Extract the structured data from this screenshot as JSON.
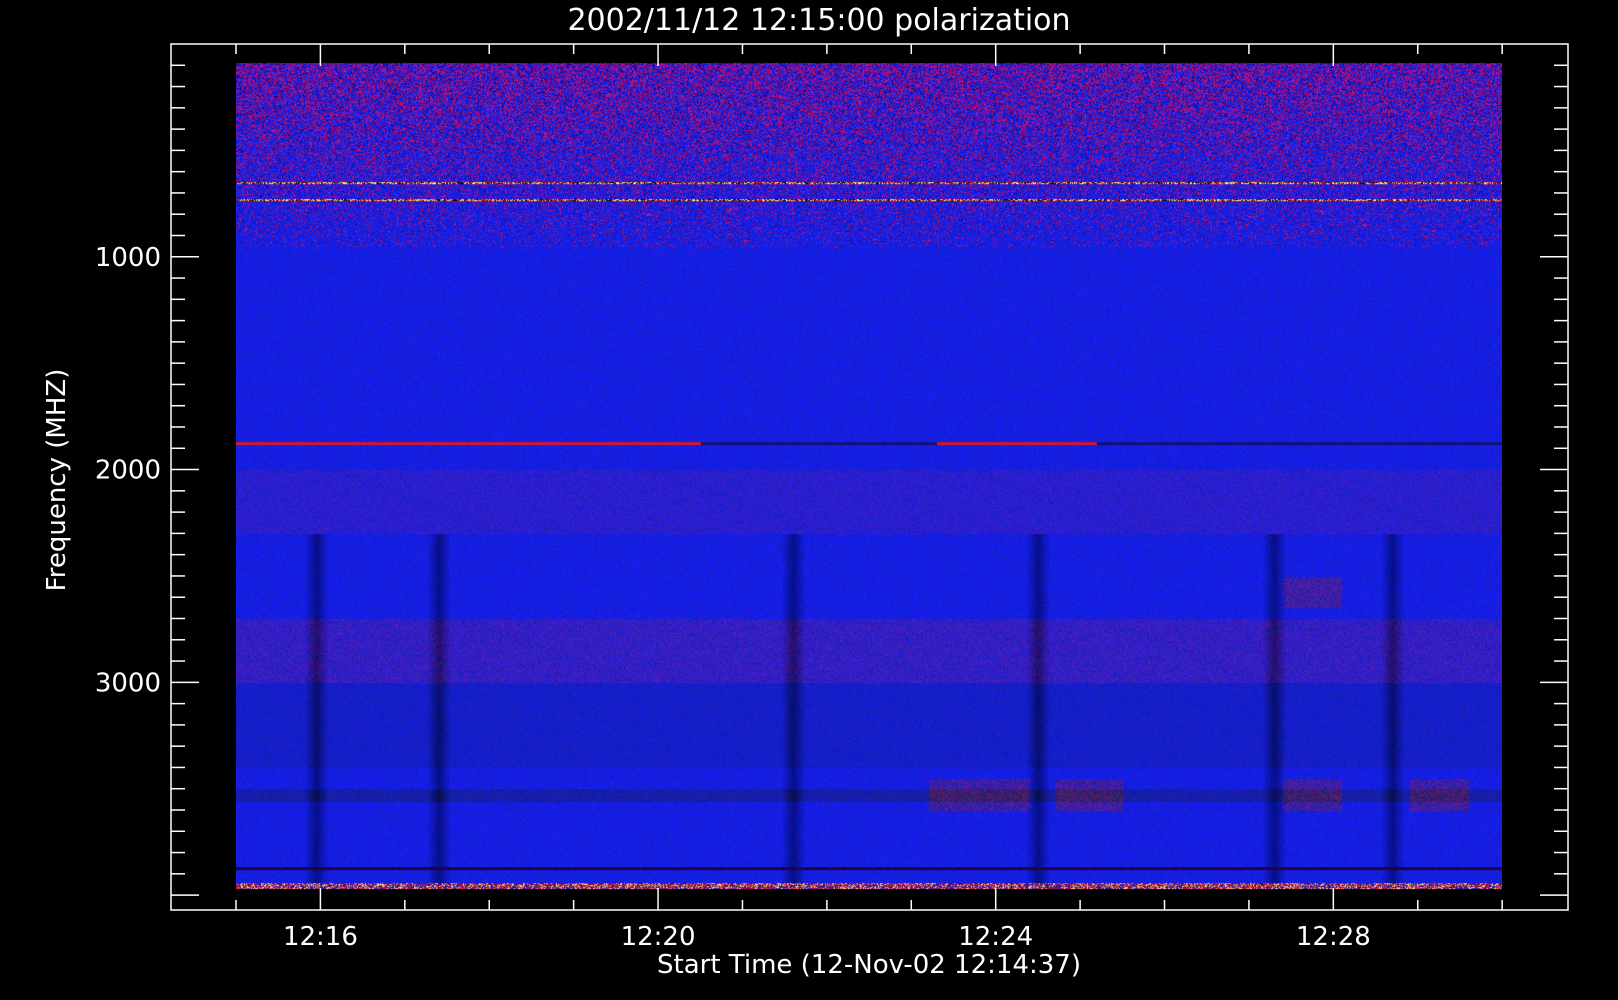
{
  "chart_data": {
    "type": "heatmap",
    "title": "2002/11/12 12:15:00 polarization",
    "xlabel": "Start Time (12-Nov-02 12:14:37)",
    "ylabel": "Frequency (MHZ)",
    "x_tick_labels": [
      "12:16",
      "12:20",
      "12:24",
      "12:28"
    ],
    "x_ticks_minutes": [
      16,
      20,
      24,
      28
    ],
    "x_data_range_minutes": [
      15.0,
      30.0
    ],
    "x_axis_range_minutes": [
      14.23,
      30.78
    ],
    "y_tick_labels": [
      "1000",
      "2000",
      "3000"
    ],
    "y_ticks": [
      1000,
      2000,
      3000
    ],
    "y_data_range": [
      90,
      3970
    ],
    "y_axis_range": [
      0,
      4070
    ],
    "y_reversed": true,
    "colors": {
      "background": "#000000",
      "base": "#1a22e8",
      "noise_red": "#b0181e",
      "hot": "#ffd27a",
      "dark": "#050525"
    },
    "features": {
      "hot_lines_mhz": [
        650,
        730
      ],
      "red_line_mhz": 1875,
      "dark_band_mhz": [
        3500,
        3560
      ],
      "dark_line_mhz": 3870,
      "noisy_bottom_mhz": [
        3940,
        3970
      ],
      "dark_columns_minutes": [
        15.95,
        17.4,
        21.6,
        24.5,
        27.3,
        28.7
      ],
      "red_patches": [
        {
          "t": [
            23.2,
            24.4
          ],
          "f": [
            3450,
            3600
          ]
        },
        {
          "t": [
            24.7,
            25.5
          ],
          "f": [
            3450,
            3600
          ]
        },
        {
          "t": [
            27.4,
            28.1
          ],
          "f": [
            3450,
            3600
          ]
        },
        {
          "t": [
            28.9,
            29.6
          ],
          "f": [
            3450,
            3600
          ]
        },
        {
          "t": [
            27.4,
            28.1
          ],
          "f": [
            2500,
            2650
          ]
        }
      ]
    }
  }
}
